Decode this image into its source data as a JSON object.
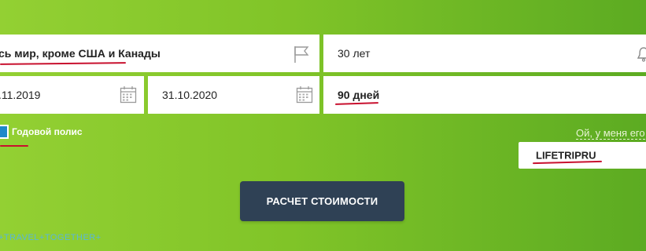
{
  "form": {
    "destination": {
      "value": "сь мир, кроме США и Канады",
      "icon": "flag-icon"
    },
    "age": {
      "value": "30 лет",
      "icon": "bell-icon"
    },
    "start_date": {
      "value": ".11.2019",
      "icon": "calendar-icon"
    },
    "end_date": {
      "value": "31.10.2020",
      "icon": "calendar-icon"
    },
    "duration": {
      "value": "90 дней"
    },
    "annual_policy": {
      "label": "Годовой полис",
      "checked": true
    },
    "promo_link": "Ой, у меня его",
    "promo_code": {
      "value": "LIFETRIPRU"
    },
    "submit_label": "РАСЧЕТ СТОИМОСТИ"
  },
  "watermark": "+TRAVEL+TOGETHER+",
  "colors": {
    "background": "#80c428",
    "button": "#2f4155",
    "checkbox": "#1e88c8",
    "annotation": "#c8102e"
  }
}
